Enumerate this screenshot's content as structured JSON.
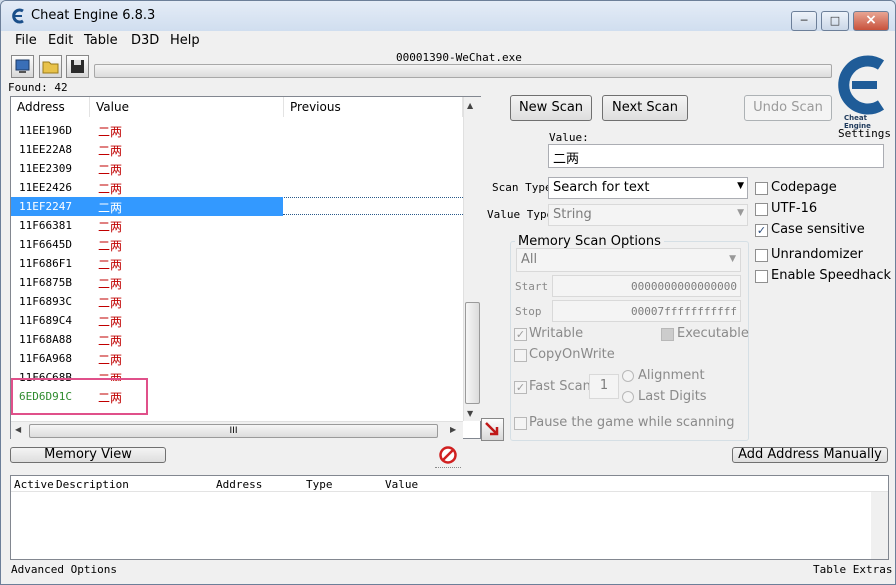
{
  "window": {
    "title": "Cheat Engine 6.8.3",
    "process_title": "00001390-WeChat.exe"
  },
  "menu": [
    "File",
    "Edit",
    "Table",
    "D3D",
    "Help"
  ],
  "found_label": "Found: 42",
  "results": {
    "columns": [
      "Address",
      "Value",
      "Previous"
    ],
    "rows": [
      {
        "address": "11EE196D",
        "value": "二两"
      },
      {
        "address": "11EE22A8",
        "value": "二两"
      },
      {
        "address": "11EE2309",
        "value": "二两"
      },
      {
        "address": "11EE2426",
        "value": "二两"
      },
      {
        "address": "11EF2247",
        "value": "二两"
      },
      {
        "address": "11F66381",
        "value": "二两"
      },
      {
        "address": "11F6645D",
        "value": "二两"
      },
      {
        "address": "11F686F1",
        "value": "二两"
      },
      {
        "address": "11F6875B",
        "value": "二两"
      },
      {
        "address": "11F6893C",
        "value": "二两"
      },
      {
        "address": "11F689C4",
        "value": "二两"
      },
      {
        "address": "11F68A88",
        "value": "二两"
      },
      {
        "address": "11F6A968",
        "value": "二两"
      },
      {
        "address": "11F6C68B",
        "value": "二两"
      },
      {
        "address": "6ED6D91C",
        "value": "二两"
      }
    ],
    "selected_index": 4,
    "highlighted_index": 14,
    "static_address_color": "#2e8b2e",
    "value_color": "#c00000",
    "hscroll_grip": "III"
  },
  "buttons": {
    "new_scan": "New Scan",
    "next_scan": "Next Scan",
    "undo_scan": "Undo Scan",
    "memory_view": "Memory View",
    "add_address": "Add Address Manually"
  },
  "settings_label": "Settings",
  "logo_caption": "Cheat Engine",
  "value_label": "Value:",
  "value_input": "二两",
  "scan_type": {
    "label": "Scan Type",
    "selected": "Search for text"
  },
  "value_type": {
    "label": "Value Type",
    "selected": "String"
  },
  "right_options": [
    {
      "label": "Codepage",
      "checked": false
    },
    {
      "label": "UTF-16",
      "checked": false
    },
    {
      "label": "Case sensitive",
      "checked": true
    },
    {
      "label": "Unrandomizer",
      "checked": false
    },
    {
      "label": "Enable Speedhack",
      "checked": false
    }
  ],
  "memory_options": {
    "title": "Memory Scan Options",
    "region": "All",
    "start_label": "Start",
    "start_value": "0000000000000000",
    "stop_label": "Stop",
    "stop_value": "00007fffffffffff",
    "writable": "Writable",
    "executable": "Executable",
    "copy_on_write": "CopyOnWrite",
    "fast_scan": "Fast Scan",
    "fast_scan_value": "1",
    "alignment": "Alignment",
    "last_digits": "Last Digits",
    "pause": "Pause the game while scanning"
  },
  "lower_columns": [
    "Active",
    "Description",
    "Address",
    "Type",
    "Value"
  ],
  "status": {
    "left": "Advanced Options",
    "right": "Table Extras"
  },
  "colors": {
    "accent_select": "#3399ff",
    "highlight_box": "#e0508a"
  }
}
